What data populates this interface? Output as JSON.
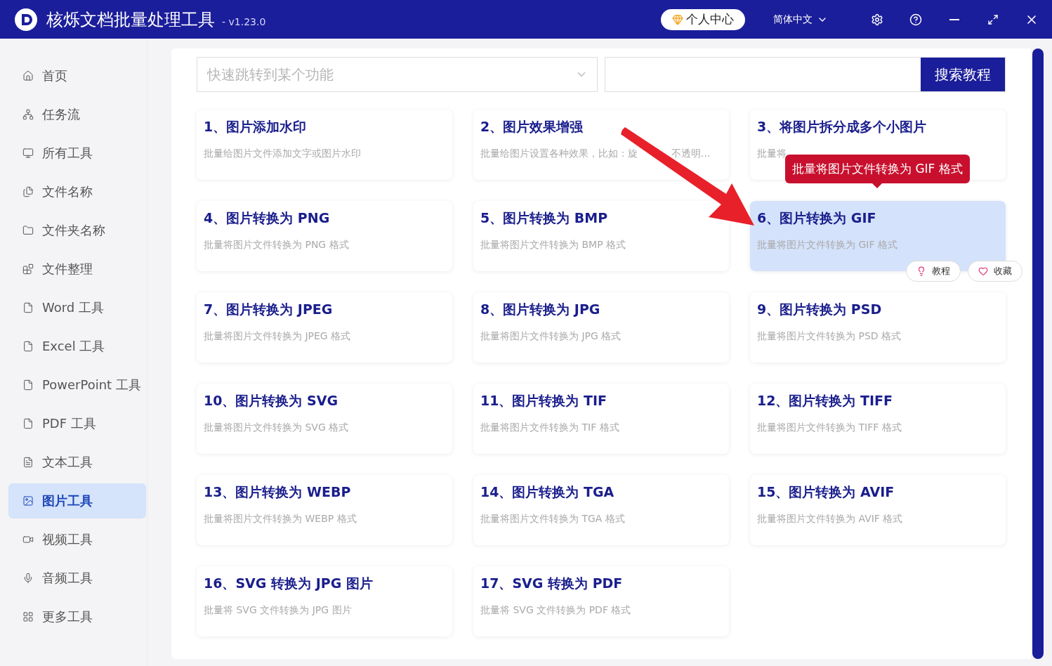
{
  "window": {
    "title": "核烁文档批量处理工具",
    "version": "- v1.23.0"
  },
  "header": {
    "user_center": "个人中心",
    "language": "简体中文"
  },
  "sidebar": {
    "items": [
      {
        "label": "首页",
        "selected": false
      },
      {
        "label": "任务流",
        "selected": false
      },
      {
        "label": "所有工具",
        "selected": false
      },
      {
        "label": "文件名称",
        "selected": false
      },
      {
        "label": "文件夹名称",
        "selected": false
      },
      {
        "label": "文件整理",
        "selected": false
      },
      {
        "label": "Word 工具",
        "selected": false
      },
      {
        "label": "Excel 工具",
        "selected": false
      },
      {
        "label": "PowerPoint 工具",
        "selected": false
      },
      {
        "label": "PDF 工具",
        "selected": false
      },
      {
        "label": "文本工具",
        "selected": false
      },
      {
        "label": "图片工具",
        "selected": true
      },
      {
        "label": "视频工具",
        "selected": false
      },
      {
        "label": "音频工具",
        "selected": false
      },
      {
        "label": "更多工具",
        "selected": false
      }
    ]
  },
  "search": {
    "jump_placeholder": "快速跳转到某个功能",
    "tutorial_button": "搜索教程"
  },
  "cards": [
    {
      "title": "1、图片添加水印",
      "description": "批量给图片文件添加文字或图片水印",
      "selected": false
    },
    {
      "title": "2、图片效果增强",
      "description": "批量给图片设置各种效果，比如：旋",
      "description_tail": "不透明...",
      "selected": false
    },
    {
      "title": "3、将图片拆分成多个小图片",
      "description": "批量将",
      "selected": false
    },
    {
      "title": "4、图片转换为 PNG",
      "description": "批量将图片文件转换为 PNG 格式",
      "selected": false
    },
    {
      "title": "5、图片转换为 BMP",
      "description": "批量将图片文件转换为 BMP 格式",
      "selected": false
    },
    {
      "title": "6、图片转换为 GIF",
      "description": "批量将图片文件转换为 GIF 格式",
      "selected": true,
      "actions": [
        "教程",
        "收藏"
      ]
    },
    {
      "title": "7、图片转换为 JPEG",
      "description": "批量将图片文件转换为 JPEG 格式",
      "selected": false
    },
    {
      "title": "8、图片转换为 JPG",
      "description": "批量将图片文件转换为 JPG 格式",
      "selected": false
    },
    {
      "title": "9、图片转换为 PSD",
      "description": "批量将图片文件转换为 PSD 格式",
      "selected": false
    },
    {
      "title": "10、图片转换为 SVG",
      "description": "批量将图片文件转换为 SVG 格式",
      "selected": false
    },
    {
      "title": "11、图片转换为 TIF",
      "description": "批量将图片文件转换为 TIF 格式",
      "selected": false
    },
    {
      "title": "12、图片转换为 TIFF",
      "description": "批量将图片文件转换为 TIFF 格式",
      "selected": false
    },
    {
      "title": "13、图片转换为 WEBP",
      "description": "批量将图片文件转换为 WEBP 格式",
      "selected": false
    },
    {
      "title": "14、图片转换为 TGA",
      "description": "批量将图片文件转换为 TGA 格式",
      "selected": false
    },
    {
      "title": "15、图片转换为 AVIF",
      "description": "批量将图片文件转换为 AVIF 格式",
      "selected": false
    },
    {
      "title": "16、SVG 转换为 JPG 图片",
      "description": "批量将 SVG 文件转换为 JPG 图片",
      "selected": false
    },
    {
      "title": "17、SVG 转换为 PDF",
      "description": "批量将 SVG 文件转换为 PDF 格式",
      "selected": false
    }
  ],
  "tooltip": {
    "text": "批量将图片文件转换为 GIF 格式"
  }
}
